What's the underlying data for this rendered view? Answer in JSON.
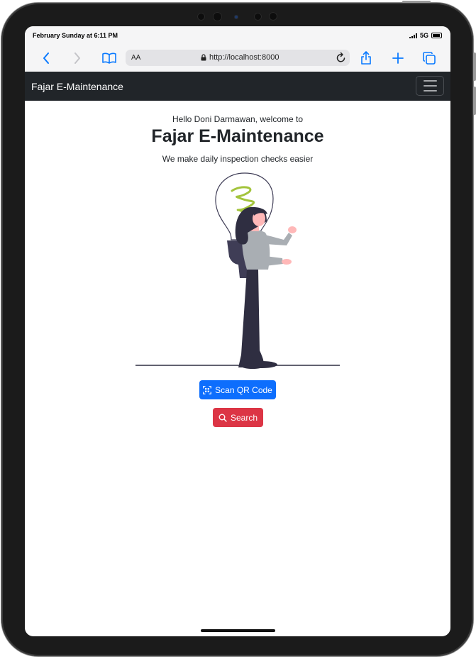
{
  "status_bar": {
    "time": "February Sunday at 6:11 PM",
    "network": "5G"
  },
  "browser": {
    "text_size_label": "AA",
    "url": "http://localhost:8000"
  },
  "navbar": {
    "brand": "Fajar E-Maintenance"
  },
  "hero": {
    "greeting": "Hello Doni Darmawan, welcome to",
    "title": "Fajar E-Maintenance",
    "subtitle": "We make daily inspection checks easier"
  },
  "actions": {
    "scan_label": "Scan QR Code",
    "search_label": "Search"
  },
  "colors": {
    "navbar_bg": "#212529",
    "primary": "#0d6efd",
    "danger": "#dc3545",
    "accent_green": "#a3c43c"
  }
}
